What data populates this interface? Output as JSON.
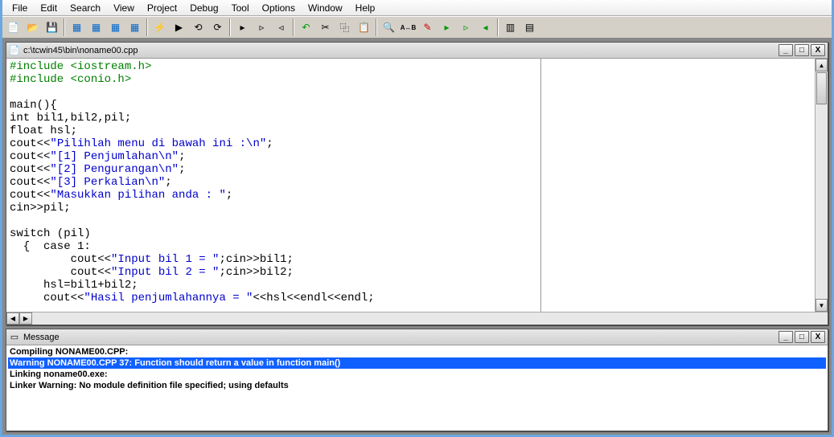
{
  "menu": {
    "items": [
      "File",
      "Edit",
      "Search",
      "View",
      "Project",
      "Debug",
      "Tool",
      "Options",
      "Window",
      "Help"
    ]
  },
  "editor": {
    "title": "c:\\tcwin45\\bin\\noname00.cpp",
    "code_plain": "#include <iostream.h>\n#include <conio.h>\n\nmain(){\nint bil1,bil2,pil;\nfloat hsl;\ncout<<\"Pilihlah menu di bawah ini :\\n\";\ncout<<\"[1] Penjumlahan\\n\";\ncout<<\"[2] Pengurangan\\n\";\ncout<<\"[3] Perkalian\\n\";\ncout<<\"Masukkan pilihan anda : \";\ncin>>pil;\n\nswitch (pil)\n  {  case 1:\n         cout<<\"Input bil 1 = \";cin>>bil1;\n         cout<<\"Input bil 2 = \";cin>>bil2;\n     hsl=bil1+bil2;\n     cout<<\"Hasil penjumlahannya = \"<<hsl<<endl<<endl;",
    "code_tokens": [
      [
        {
          "t": "#include <iostream.h>",
          "c": "g"
        }
      ],
      [
        {
          "t": "#include <conio.h>",
          "c": "g"
        }
      ],
      [],
      [
        {
          "t": "main(){",
          "c": "k"
        }
      ],
      [
        {
          "t": "int bil1,bil2,pil;",
          "c": "k"
        }
      ],
      [
        {
          "t": "float hsl;",
          "c": "k"
        }
      ],
      [
        {
          "t": "cout<<",
          "c": "k"
        },
        {
          "t": "\"Pilihlah menu di bawah ini :\\n\"",
          "c": "b"
        },
        {
          "t": ";",
          "c": "k"
        }
      ],
      [
        {
          "t": "cout<<",
          "c": "k"
        },
        {
          "t": "\"[1] Penjumlahan\\n\"",
          "c": "b"
        },
        {
          "t": ";",
          "c": "k"
        }
      ],
      [
        {
          "t": "cout<<",
          "c": "k"
        },
        {
          "t": "\"[2] Pengurangan\\n\"",
          "c": "b"
        },
        {
          "t": ";",
          "c": "k"
        }
      ],
      [
        {
          "t": "cout<<",
          "c": "k"
        },
        {
          "t": "\"[3] Perkalian\\n\"",
          "c": "b"
        },
        {
          "t": ";",
          "c": "k"
        }
      ],
      [
        {
          "t": "cout<<",
          "c": "k"
        },
        {
          "t": "\"Masukkan pilihan anda : \"",
          "c": "b"
        },
        {
          "t": ";",
          "c": "k"
        }
      ],
      [
        {
          "t": "cin>>pil;",
          "c": "k"
        }
      ],
      [],
      [
        {
          "t": "switch (pil)",
          "c": "k"
        }
      ],
      [
        {
          "t": "  {  case 1:",
          "c": "k"
        }
      ],
      [
        {
          "t": "         cout<<",
          "c": "k"
        },
        {
          "t": "\"Input bil 1 = \"",
          "c": "b"
        },
        {
          "t": ";cin>>bil1;",
          "c": "k"
        }
      ],
      [
        {
          "t": "         cout<<",
          "c": "k"
        },
        {
          "t": "\"Input bil 2 = \"",
          "c": "b"
        },
        {
          "t": ";cin>>bil2;",
          "c": "k"
        }
      ],
      [
        {
          "t": "     hsl=bil1+bil2;",
          "c": "k"
        }
      ],
      [
        {
          "t": "     cout<<",
          "c": "k"
        },
        {
          "t": "\"Hasil penjumlahannya = \"",
          "c": "b"
        },
        {
          "t": "<<hsl<<endl<<endl;",
          "c": "k"
        }
      ]
    ]
  },
  "messages": {
    "title": "Message",
    "lines": [
      {
        "text": "Compiling NONAME00.CPP:",
        "sel": false
      },
      {
        "text": "Warning NONAME00.CPP 37: Function should return a value in function main()",
        "sel": true
      },
      {
        "text": "Linking noname00.exe:",
        "sel": false
      },
      {
        "text": "Linker Warning: No module definition file specified; using defaults",
        "sel": false
      }
    ]
  },
  "winbtns": {
    "min": "_",
    "max": "□",
    "close": "X"
  }
}
